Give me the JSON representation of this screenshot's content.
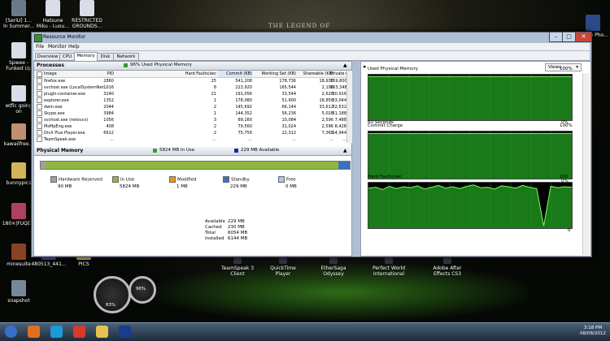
{
  "desktop": {
    "wallpaper_title": "THE LEGEND OF",
    "icons": [
      {
        "name": "seriously-icon",
        "label": "[SeriU]  1...\nIn Summer...",
        "color": "#6a7a8a"
      },
      {
        "name": "hatsune-icon",
        "label": "Hatsune\nMiku - Luou...",
        "color": "#d8dde8"
      },
      {
        "name": "restricted-grounds-icon",
        "label": "RESTRICTED\nGROUNDS...",
        "color": "#d8dde8"
      },
      {
        "name": "adobe-icon",
        "label": "Adobe Pho...",
        "color": "#2a4a8a"
      },
      {
        "name": "spwee-icon",
        "label": "Spwee -\nFunked Up",
        "color": "#d8dde8"
      },
      {
        "name": "wtfic-icon",
        "label": "wtfic going\non",
        "color": "#d8dde8"
      },
      {
        "name": "kawaiifree-icon",
        "label": "kawaiifree...",
        "color": "#c09070"
      },
      {
        "name": "bunnypics-icon",
        "label": "bunnypics",
        "color": "#d4b45a"
      },
      {
        "name": "anime-icon",
        "label": "180×|FUQE...",
        "color": "#b04060"
      },
      {
        "name": "minesuite-icon",
        "label": "minesuite",
        "color": "#884422"
      },
      {
        "name": "file-480513-icon",
        "label": "480513_441...",
        "color": "#3a5a8a"
      },
      {
        "name": "pics-icon",
        "label": "PICS",
        "color": "#d4b45a"
      },
      {
        "name": "snapshot-icon",
        "label": "snapshot",
        "color": "#778899"
      }
    ],
    "shortcuts": [
      {
        "name": "teamspeak-icon",
        "label": "TeamSpeak 3\nClient"
      },
      {
        "name": "quicktime-icon",
        "label": "QuickTime\nPlayer"
      },
      {
        "name": "ethersaga-icon",
        "label": "EtherSaga\nOdyssey"
      },
      {
        "name": "perfectworld-icon",
        "label": "Perfect World\nInternational"
      },
      {
        "name": "aftereffects-icon",
        "label": "Adobe After\nEffects CS3"
      }
    ],
    "gadget": {
      "cpu": "83%",
      "mem": "96%"
    }
  },
  "window": {
    "title": "Resource Monitor",
    "menu": [
      "File",
      "Monitor",
      "Help"
    ],
    "tabs": [
      "Overview",
      "CPU",
      "Memory",
      "Disk",
      "Network"
    ],
    "active_tab": "Memory",
    "processes": {
      "title": "Processes",
      "summary": "96% Used Physical Memory",
      "summary_color": "#2fa02f",
      "columns": [
        "Image",
        "PID",
        "Hard Faults/sec",
        "Commit (KB)",
        "Working Set (KB)",
        "Shareable (KB)",
        "Private (KB)"
      ],
      "rows": [
        [
          "firefox.exe",
          "2860",
          "25",
          "541,208",
          "178,736",
          "18,936",
          "159,800"
        ],
        [
          "svchost.exe (LocalSystemNet...",
          "1016",
          "8",
          "223,920",
          "165,544",
          "2,196",
          "163,348"
        ],
        [
          "plugin-container.exe",
          "3240",
          "21",
          "191,056",
          "33,544",
          "2,628",
          "30,916"
        ],
        [
          "explorer.exe",
          "1352",
          "1",
          "178,080",
          "51,900",
          "18,856",
          "33,044"
        ],
        [
          "dwm.exe",
          "2044",
          "2",
          "145,692",
          "66,144",
          "33,612",
          "32,532"
        ],
        [
          "Skype.exe",
          "3984",
          "1",
          "144,352",
          "56,236",
          "5,028",
          "51,188"
        ],
        [
          "svchost.exe (netsvcs)",
          "1056",
          "3",
          "89,160",
          "10,084",
          "2,596",
          "7,488"
        ],
        [
          "MsMpEng.exe",
          "408",
          "2",
          "79,560",
          "31,024",
          "2,596",
          "8,428"
        ],
        [
          "DivX Plus Player.exe",
          "6612",
          "2",
          "75,756",
          "22,312",
          "7,368",
          "14,944"
        ],
        [
          "TeamSpeak.exe",
          "...",
          "...",
          "...",
          "...",
          "...",
          "..."
        ]
      ]
    },
    "physical_memory": {
      "title": "Physical Memory",
      "in_use_label": "5824 MB In Use",
      "available_label": "229 MB Available",
      "legend": [
        {
          "label": "Hardware Reserved",
          "value": "90 MB",
          "color": "#a0a0a0"
        },
        {
          "label": "In Use",
          "value": "5824 MB",
          "color": "#8db83a"
        },
        {
          "label": "Modified",
          "value": "1 MB",
          "color": "#e8961c"
        },
        {
          "label": "Standby",
          "value": "229 MB",
          "color": "#3b6fc4"
        },
        {
          "label": "Free",
          "value": "0 MB",
          "color": "#a6c8ec"
        }
      ],
      "bar": [
        {
          "part": "hardware-reserved",
          "mb": 90,
          "color": "#a0a0a0"
        },
        {
          "part": "in-use",
          "mb": 5824,
          "color": "#8db83a"
        },
        {
          "part": "modified",
          "mb": 1,
          "color": "#e8961c"
        },
        {
          "part": "standby",
          "mb": 229,
          "color": "#3b6fc4"
        },
        {
          "part": "free",
          "mb": 0,
          "color": "#a6c8ec"
        }
      ],
      "stats": [
        {
          "label": "Available",
          "value": "229 MB"
        },
        {
          "label": "Cached",
          "value": "230 MB"
        },
        {
          "label": "Total",
          "value": "6054 MB"
        },
        {
          "label": "Installed",
          "value": "6144 MB"
        }
      ]
    },
    "views_button": "Views",
    "charts": [
      {
        "title": "Used Physical Memory",
        "max": "100%",
        "min": "0%",
        "footer": "60 Seconds",
        "values": [
          96,
          96,
          96,
          96,
          96,
          96,
          96,
          96,
          96,
          96,
          96,
          96,
          96,
          96,
          96,
          96,
          96,
          96,
          96,
          96,
          96,
          96,
          96,
          96,
          96,
          96,
          96,
          96,
          96,
          96
        ]
      },
      {
        "title": "Commit Charge",
        "max": "100%",
        "min": "0%",
        "footer": "",
        "values": [
          96,
          96,
          96,
          96,
          96,
          96,
          96,
          96,
          96,
          96,
          96,
          96,
          96,
          96,
          96,
          96,
          96,
          96,
          96,
          96,
          96,
          96,
          96,
          96,
          96,
          96,
          96,
          96,
          96,
          96
        ]
      },
      {
        "title": "Hard Faults/sec",
        "max": "100",
        "min": "0",
        "footer": "",
        "values": [
          88,
          90,
          85,
          92,
          87,
          91,
          89,
          93,
          86,
          90,
          94,
          88,
          91,
          87,
          92,
          95,
          89,
          90,
          86,
          93,
          91,
          88,
          94,
          90,
          87,
          5,
          92,
          89,
          91,
          90
        ]
      }
    ]
  },
  "taskbar": {
    "time": "3:18 PM",
    "date": "08/08/2012",
    "apps": [
      "start-orb-icon",
      "firefox-icon",
      "skype-icon",
      "chrome-icon",
      "folder-icon",
      "photoshop-icon"
    ]
  }
}
